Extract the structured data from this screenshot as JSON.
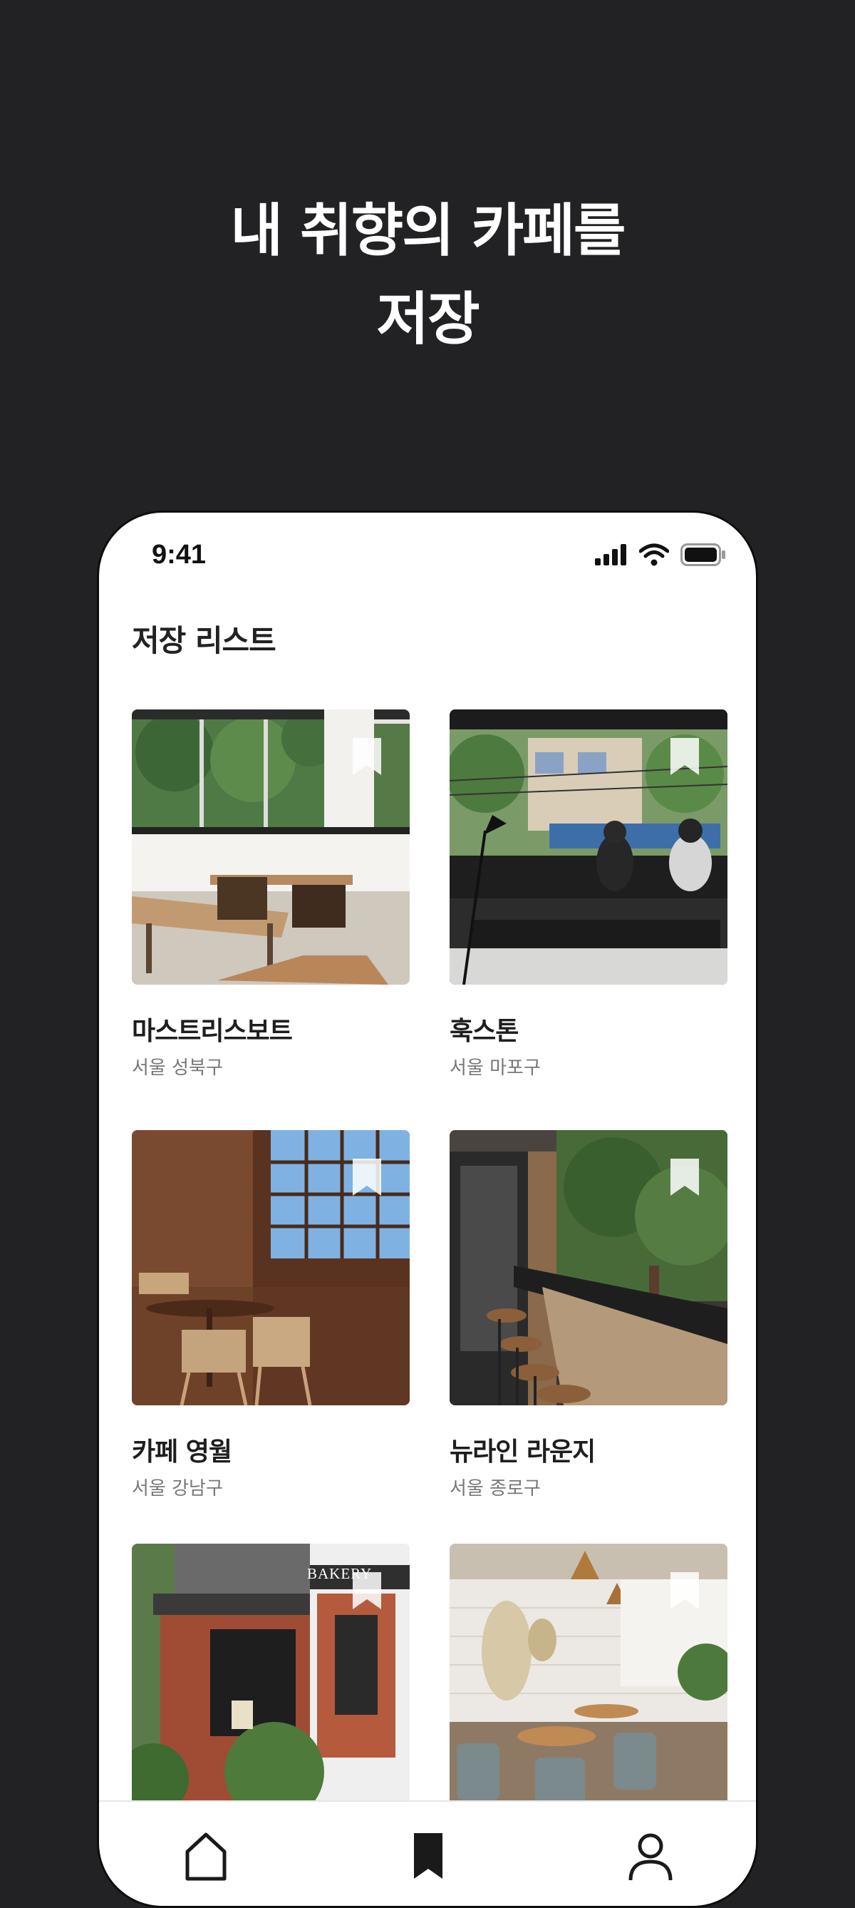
{
  "promo": {
    "line1": "내 취향의 카페를",
    "line2": "저장"
  },
  "status_bar": {
    "time": "9:41",
    "icons": [
      "signal-icon",
      "wifi-icon",
      "battery-icon"
    ]
  },
  "screen": {
    "title": "저장 리스트"
  },
  "cafes": [
    {
      "name": "마스트리스보트",
      "location": "서울 성북구",
      "icon": "bookmark-icon"
    },
    {
      "name": "훅스톤",
      "location": "서울 마포구",
      "icon": "bookmark-icon"
    },
    {
      "name": "카페 영월",
      "location": "서울 강남구",
      "icon": "bookmark-icon"
    },
    {
      "name": "뉴라인 라운지",
      "location": "서울 종로구",
      "icon": "bookmark-icon"
    },
    {
      "name": "",
      "location": "",
      "icon": "bookmark-icon"
    },
    {
      "name": "",
      "location": "",
      "icon": "bookmark-icon"
    }
  ],
  "photo_signs": {
    "bakery": "BAKERY"
  },
  "tab_bar": {
    "items": [
      "home-icon",
      "bookmark-icon",
      "profile-icon"
    ]
  },
  "colors": {
    "background": "#222224",
    "phone": "#ffffff",
    "text_primary": "#1e1e1e",
    "text_secondary": "#777777"
  }
}
